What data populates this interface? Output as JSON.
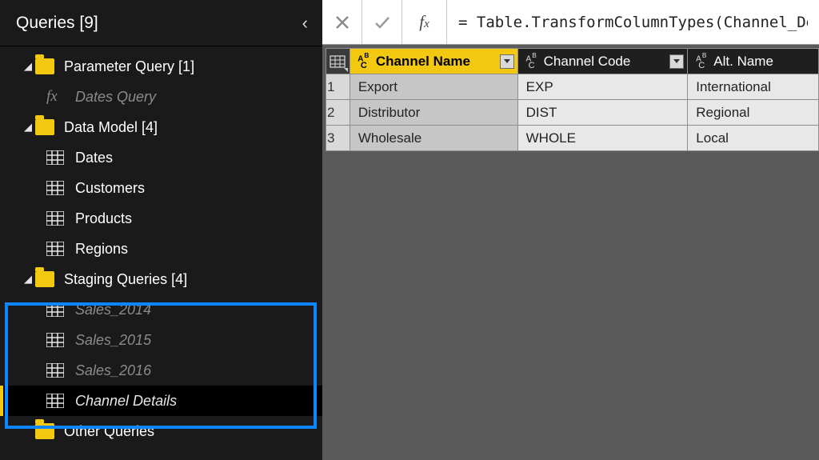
{
  "sidebar": {
    "title": "Queries [9]",
    "groups": [
      {
        "label": "Parameter Query [1]",
        "children": [
          {
            "label": "Dates Query",
            "type": "fx",
            "dim": true,
            "italic": true
          }
        ]
      },
      {
        "label": "Data Model [4]",
        "children": [
          {
            "label": "Dates",
            "type": "table"
          },
          {
            "label": "Customers",
            "type": "table"
          },
          {
            "label": "Products",
            "type": "table"
          },
          {
            "label": "Regions",
            "type": "table"
          }
        ]
      },
      {
        "label": "Staging Queries [4]",
        "children": [
          {
            "label": "Sales_2014",
            "type": "table",
            "italic": true,
            "dim": true
          },
          {
            "label": "Sales_2015",
            "type": "table",
            "italic": true,
            "dim": true
          },
          {
            "label": "Sales_2016",
            "type": "table",
            "italic": true,
            "dim": true
          },
          {
            "label": "Channel Details",
            "type": "table",
            "italic": true,
            "selected": true
          }
        ]
      },
      {
        "label": "Other Queries",
        "children": []
      }
    ]
  },
  "formula": "= Table.TransformColumnTypes(Channel_Deta",
  "columns": [
    {
      "name": "Channel Name",
      "selected": true
    },
    {
      "name": "Channel Code"
    },
    {
      "name": "Alt. Name"
    }
  ],
  "rows": [
    {
      "n": "1",
      "cells": [
        "Export",
        "EXP",
        "International"
      ]
    },
    {
      "n": "2",
      "cells": [
        "Distributor",
        "DIST",
        "Regional"
      ]
    },
    {
      "n": "3",
      "cells": [
        "Wholesale",
        "WHOLE",
        "Local"
      ]
    }
  ]
}
